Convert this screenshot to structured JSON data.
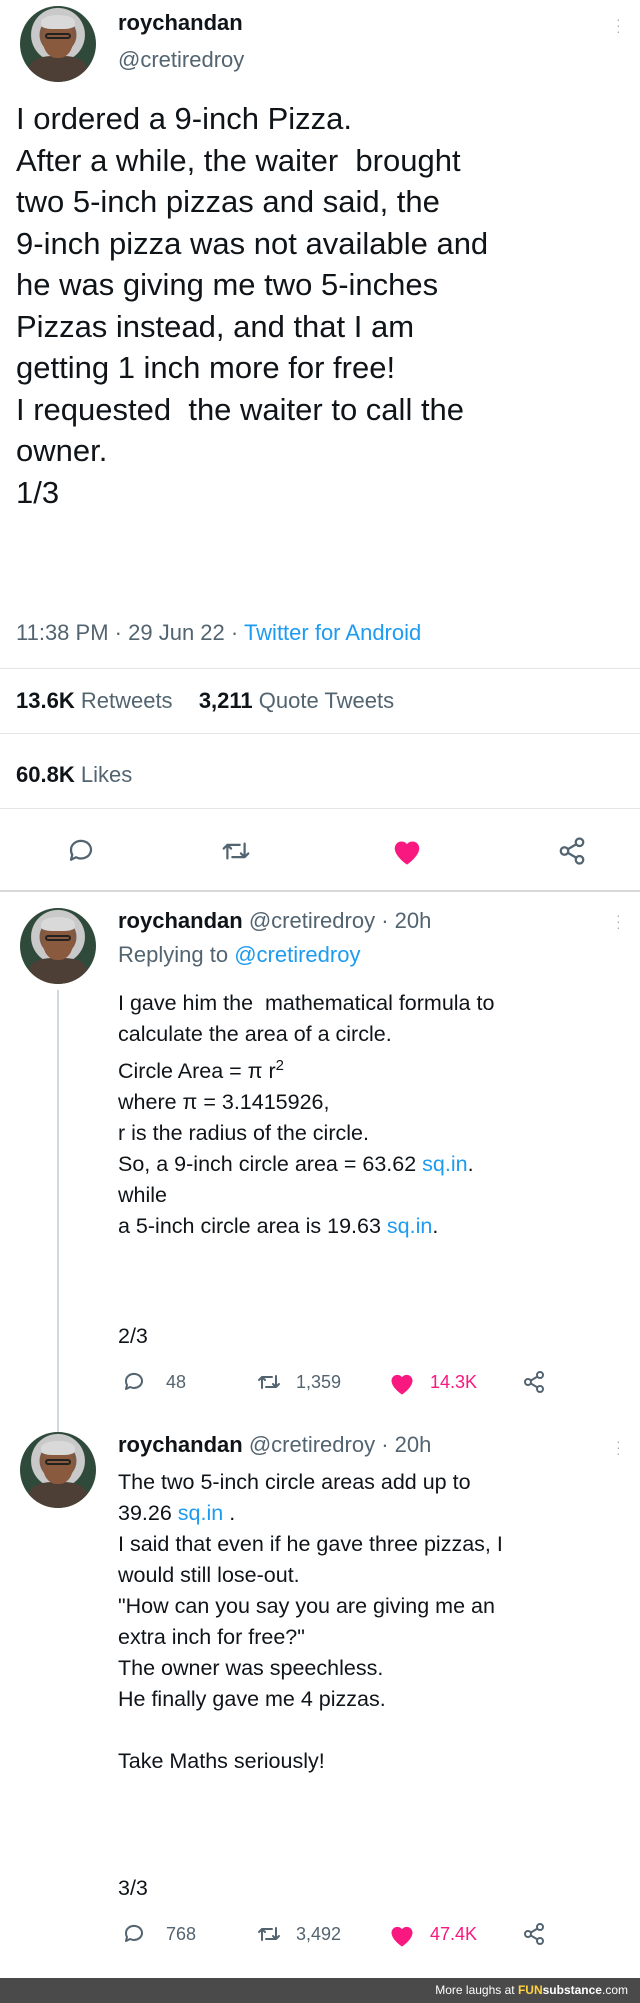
{
  "tweet1": {
    "display_name": "roychandan",
    "handle": "@cretiredroy",
    "body_lines": [
      "I ordered a 9-inch Pizza.",
      "After a while, the waiter  brought",
      "two 5-inch pizzas and said, the",
      "9-inch pizza was not available and",
      "he was giving me two 5-inches",
      "Pizzas instead, and that I am",
      "getting 1 inch more for free!",
      "I requested  the waiter to call the",
      "owner.",
      "1/3"
    ],
    "time": "11:38 PM",
    "date": "29 Jun 22",
    "source": "Twitter for Android",
    "retweets_count": "13.6K",
    "retweets_label": "Retweets",
    "quotes_count": "3,211",
    "quotes_label": "Quote Tweets",
    "likes_count": "60.8K",
    "likes_label": "Likes"
  },
  "tweet2": {
    "display_name": "roychandan",
    "handle_time": "@cretiredroy · 20h",
    "replying_prefix": "Replying to",
    "replying_handle": "@cretiredroy",
    "lines": [
      "I gave him the  mathematical formula to",
      "calculate the area of a circle.",
      "Circle Area = π r",
      "where π = 3.1415926,",
      "r is the radius of the circle.",
      "So, a 9-inch circle area = 63.62",
      "while",
      "a 5-inch circle area is 19.63"
    ],
    "superscript": "2",
    "unit_link": "sq.in",
    "period": ".",
    "page": "2/3",
    "replies": "48",
    "retweets": "1,359",
    "likes": "14.3K"
  },
  "tweet3": {
    "display_name": "roychandan",
    "handle_time": "@cretiredroy · 20h",
    "lines": [
      "The two 5-inch circle areas add up to",
      "39.26",
      "I said that even if he gave three pizzas, I",
      "would still lose-out.",
      "\"How can you say you are giving me an",
      "extra inch for free?\"",
      "The owner was speechless.",
      "He finally gave me 4 pizzas.",
      "Take Maths seriously!"
    ],
    "unit_link": "sq.in",
    "unit_suffix": " .",
    "page": "3/3",
    "replies": "768",
    "retweets": "3,492",
    "likes": "47.4K"
  },
  "footer": {
    "prefix": "More laughs at ",
    "brand_a": "FUN",
    "brand_b": "substance",
    "brand_c": ".com"
  },
  "colors": {
    "link": "#1d9bf0",
    "like": "#f91880",
    "muted": "#536471"
  }
}
